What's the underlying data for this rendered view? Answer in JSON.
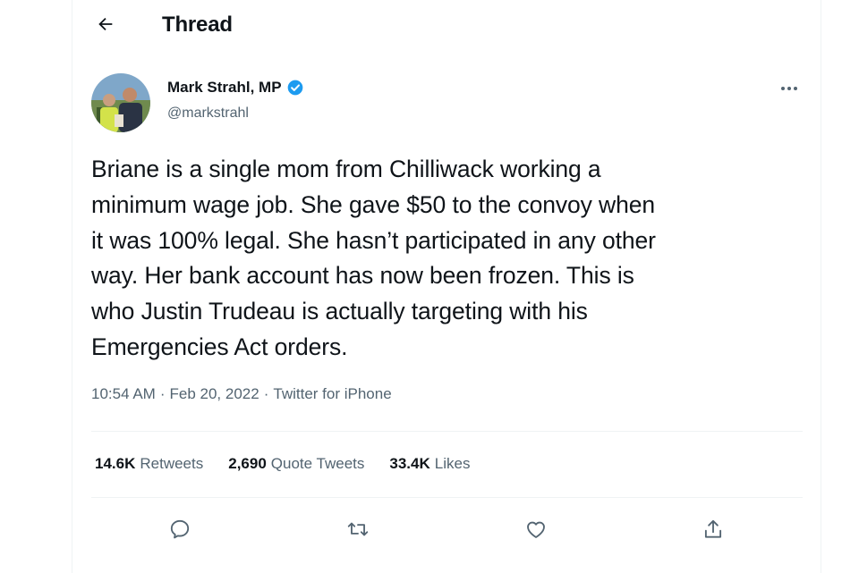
{
  "header": {
    "title": "Thread",
    "back_icon": "arrow-left-icon"
  },
  "author": {
    "display_name": "Mark Strahl, MP",
    "handle": "@markstrahl",
    "verified_icon": "verified-badge-icon",
    "verified_color": "#1d9bf0"
  },
  "tweet": {
    "text_lines": [
      "Briane is a single mom from Chilliwack working a",
      "minimum wage job. She gave $50 to the convoy when",
      "it was 100% legal. She hasn’t participated in any other",
      "way. Her bank account has now been frozen. This is",
      "who Justin Trudeau is actually targeting with his",
      "Emergencies Act orders."
    ],
    "time": "10:54 AM",
    "separator": "·",
    "date": "Feb 20, 2022",
    "source": "Twitter for iPhone"
  },
  "stats": {
    "retweets_count": "14.6K",
    "retweets_label": "Retweets",
    "quotes_count": "2,690",
    "quotes_label": "Quote Tweets",
    "likes_count": "33.4K",
    "likes_label": "Likes"
  },
  "actions": [
    "reply-icon",
    "retweet-icon",
    "like-icon",
    "share-icon"
  ],
  "colors": {
    "text": "#0f1419",
    "secondary": "#536471",
    "divider": "#eff3f4"
  }
}
